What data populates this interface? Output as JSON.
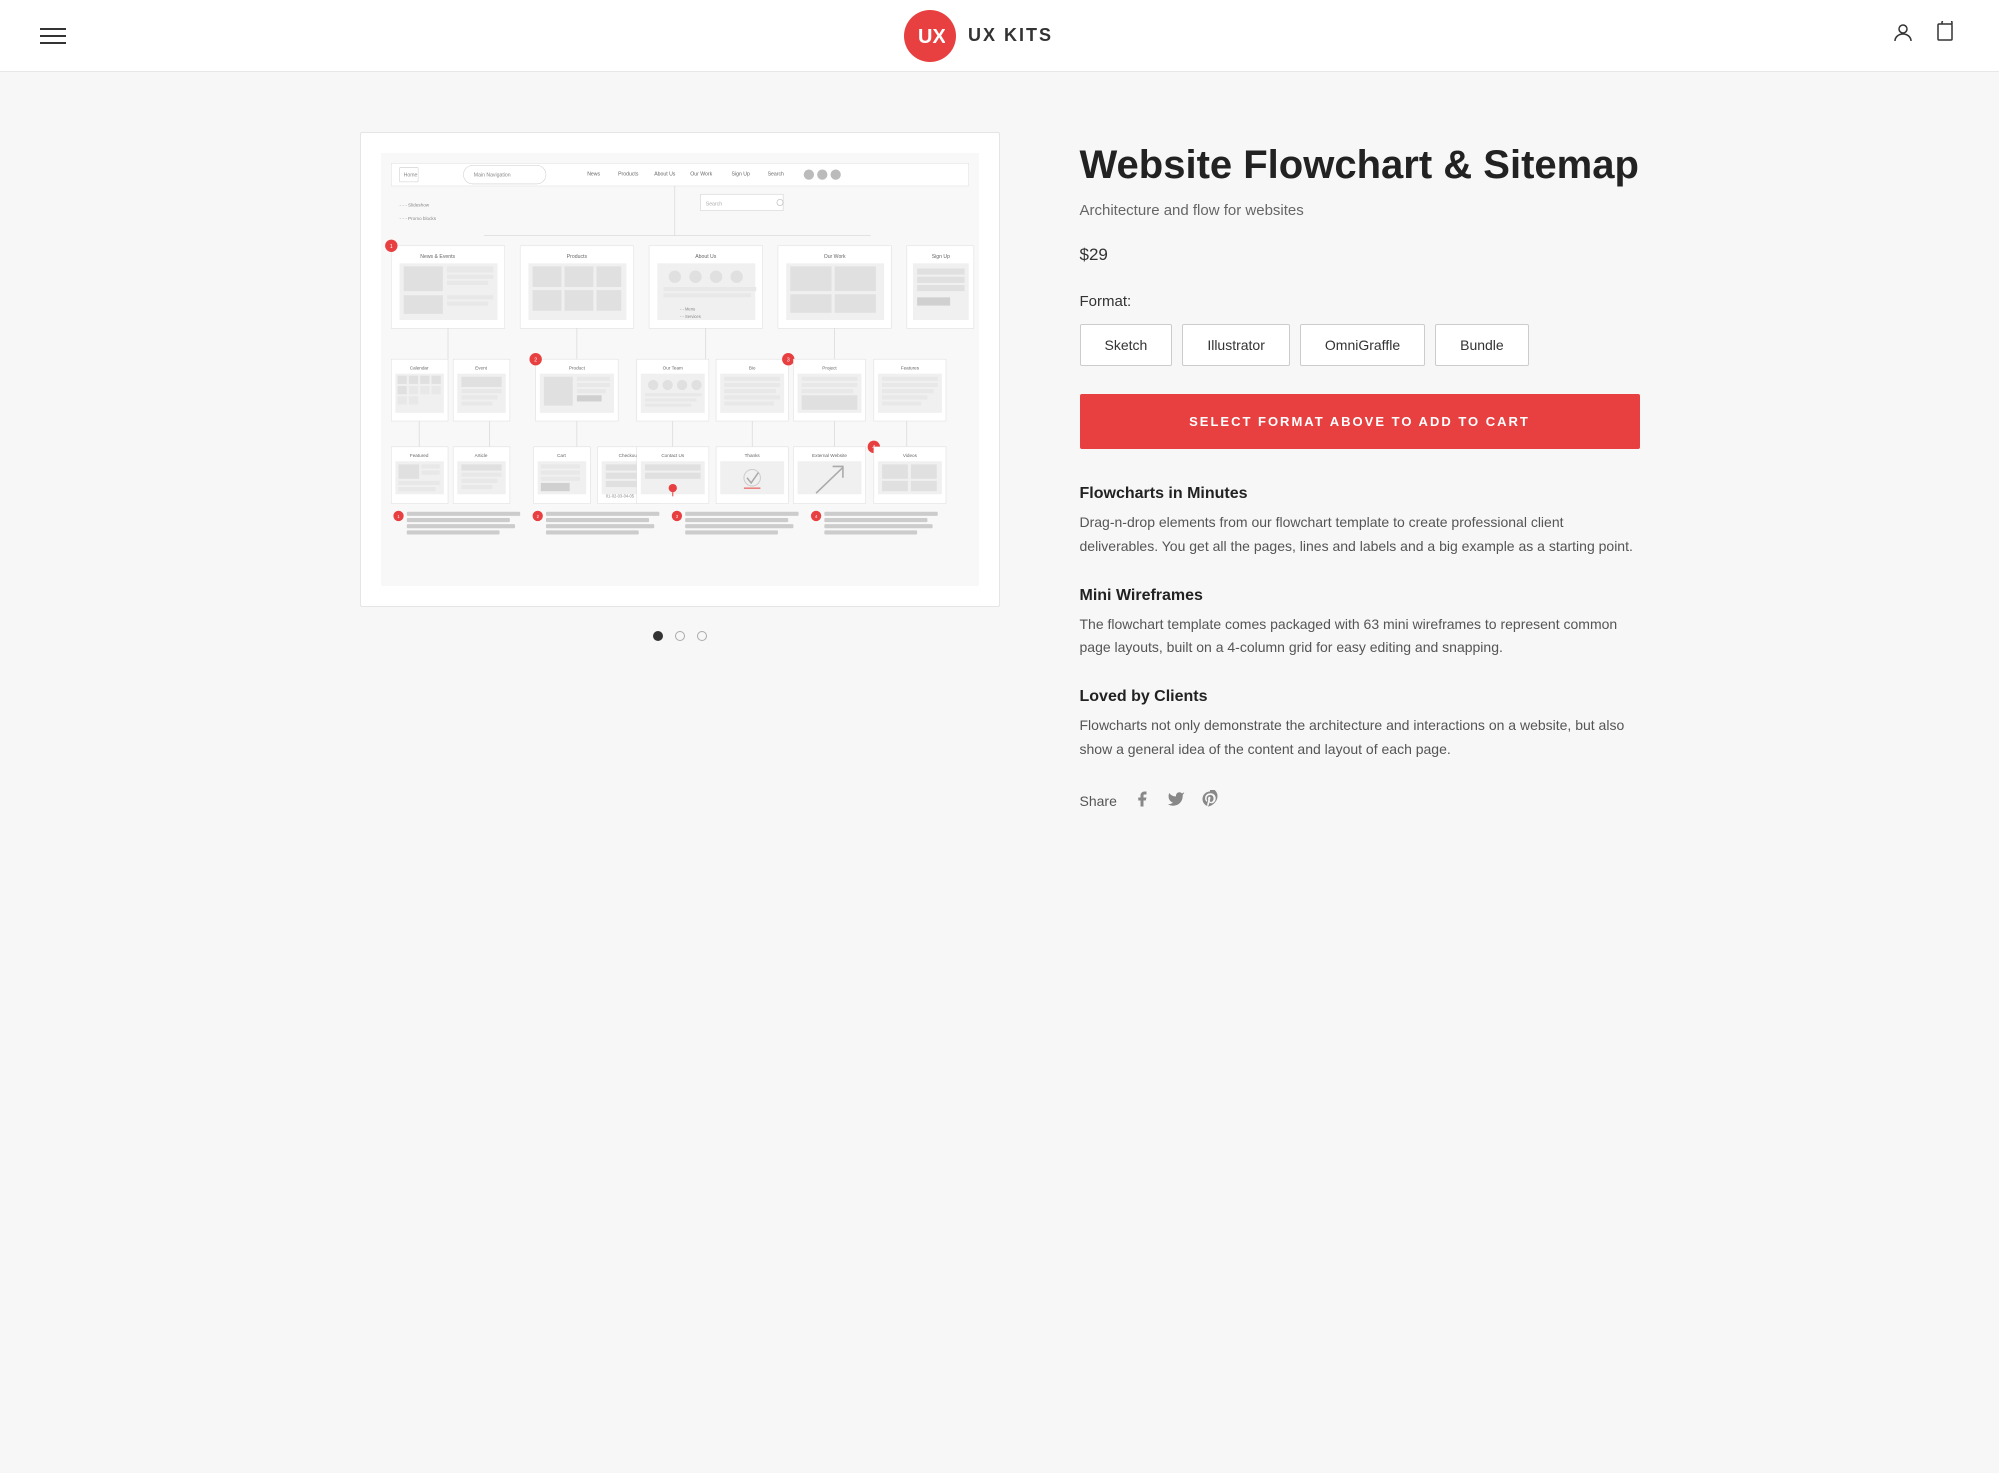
{
  "header": {
    "logo_text": "UX KITS",
    "menu_label": "Menu",
    "account_label": "Account",
    "cart_label": "Cart"
  },
  "product": {
    "title": "Website Flowchart & Sitemap",
    "subtitle": "Architecture and flow for websites",
    "price": "$29",
    "format_label": "Format:",
    "formats": [
      {
        "id": "sketch",
        "label": "Sketch"
      },
      {
        "id": "illustrator",
        "label": "Illustrator"
      },
      {
        "id": "omnigraffle",
        "label": "OmniGraffle"
      },
      {
        "id": "bundle",
        "label": "Bundle"
      }
    ],
    "add_to_cart_text": "SELECT FORMAT ABOVE TO ADD TO CART",
    "features": [
      {
        "title": "Flowcharts in Minutes",
        "text": "Drag-n-drop elements from our flowchart template to create professional client deliverables. You get all the pages, lines and labels and a big example as a starting point."
      },
      {
        "title": "Mini Wireframes",
        "text": "The flowchart template comes packaged with 63 mini wireframes to represent common page layouts, built on a 4-column grid for easy editing and snapping."
      },
      {
        "title": "Loved by Clients",
        "text": "Flowcharts not only demonstrate the architecture and interactions on a website, but also show a general idea of the content and layout of each page."
      }
    ],
    "share_label": "Share"
  },
  "dots": [
    {
      "active": true
    },
    {
      "active": false
    },
    {
      "active": false
    }
  ]
}
